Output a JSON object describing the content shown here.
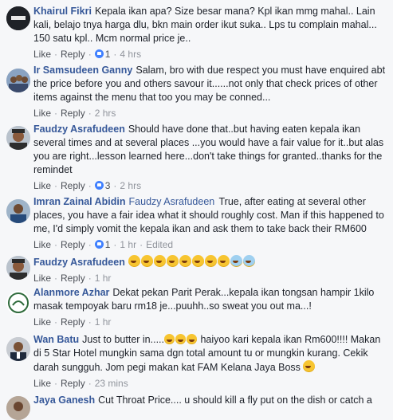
{
  "comments": [
    {
      "author": "Khairul Fikri",
      "text": "Kepala ikan apa? Size besar mana? Kpl ikan mmg mahal.. Lain kali, belajo tnya harga dlu, bkn main order ikut suka.. Lps tu complain mahal... 150 satu kpl.. Mcm normal price je..",
      "like": "Like",
      "reply": "Reply",
      "reaction_count": "1",
      "time": "4 hrs"
    },
    {
      "author": "Ir Samsudeen Ganny",
      "text": "Salam, bro with due respect you must have enquired abt the price before you and others savour it......not only that check prices of other items against the menu that too you may be conned...",
      "like": "Like",
      "reply": "Reply",
      "time": "2 hrs"
    },
    {
      "author": "Faudzy Asrafudeen",
      "text": "Should have done that..but having eaten kepala ikan several times and at several places ...you would have a fair value for it..but alas you are right...lesson learned here...don't take things for granted..thanks for the remindet",
      "like": "Like",
      "reply": "Reply",
      "reaction_count": "3",
      "time": "2 hrs"
    },
    {
      "author": "Imran Zainal Abidin",
      "mention": "Faudzy Asrafudeen",
      "text": "True, after eating at several other places, you have a fair idea what it should roughly cost. Man if this happened to me, I'd simply vomit the kepala ikan and ask them to take back their RM600",
      "like": "Like",
      "reply": "Reply",
      "reaction_count": "1",
      "time": "1 hr",
      "edited": "Edited"
    },
    {
      "author": "Faudzy Asrafudeen",
      "like": "Like",
      "reply": "Reply",
      "time": "1 hr"
    },
    {
      "author": "Alanmore Azhar",
      "text": "Dekat pekan Parit Perak...kepala ikan tongsan hampir 1kilo masak tempoyak baru rm18 je...puuhh..so sweat you out ma...!",
      "like": "Like",
      "reply": "Reply",
      "time": "1 hr"
    },
    {
      "author": "Wan Batu",
      "text_a": "Just to butter in.....",
      "text_b": " haiyoo kari kepala ikan Rm600!!!! Makan di 5 Star Hotel mungkin sama dgn total amount tu or mungkin kurang. Cekik darah sungguh. Jom pegi makan kat FAM Kelana Jaya Boss",
      "like": "Like",
      "reply": "Reply",
      "time": "23 mins"
    },
    {
      "author": "Jaya Ganesh",
      "text": "Cut Throat Price.... u should kill a fly put on the dish or catch a"
    }
  ],
  "dot": "·"
}
